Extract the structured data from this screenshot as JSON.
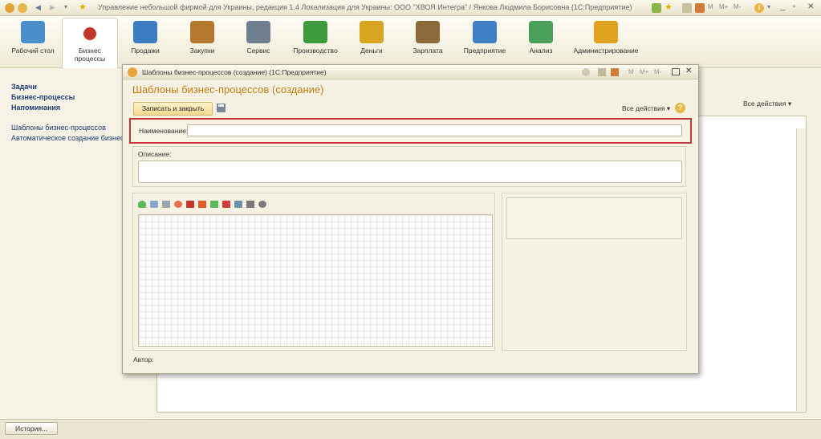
{
  "window": {
    "title": "Управление небольшой фирмой для Украины, редакция 1.4 Локализация для Украины: ООО \"ХВОЯ Интегра\" / Янкова Людмила Борисовна (1С:Предприятие)"
  },
  "sections": [
    {
      "label": "Рабочий стол",
      "icon": "desk-lamp-icon",
      "color": "#4a8fc9"
    },
    {
      "label": "Бизнес процессы",
      "icon": "business-process-icon",
      "color": "#c0392b"
    },
    {
      "label": "Продажи",
      "icon": "cash-register-icon",
      "color": "#3b7bbf"
    },
    {
      "label": "Закупки",
      "icon": "boxes-icon",
      "color": "#b5792d"
    },
    {
      "label": "Сервис",
      "icon": "tools-icon",
      "color": "#6f7f8f"
    },
    {
      "label": "Производство",
      "icon": "factory-icon",
      "color": "#3d9b3d"
    },
    {
      "label": "Деньги",
      "icon": "coins-icon",
      "color": "#d9a520"
    },
    {
      "label": "Зарплата",
      "icon": "worker-icon",
      "color": "#8a6a3b"
    },
    {
      "label": "Предприятие",
      "icon": "building-icon",
      "color": "#3f7fc4"
    },
    {
      "label": "Анализ",
      "icon": "chart-icon",
      "color": "#4aa05a"
    },
    {
      "label": "Администрирование",
      "icon": "admin-computer-icon",
      "color": "#e0a321"
    }
  ],
  "left_nav": {
    "bold_items": [
      "Задачи",
      "Бизнес-процессы",
      "Напоминания"
    ],
    "items": [
      "Шаблоны бизнес-процессов",
      "Автоматическое создание бизнес-пр"
    ]
  },
  "background_form": {
    "all_actions": "Все действия ▾"
  },
  "dialog": {
    "title": "Шаблоны бизнес-процессов (создание)  (1С:Предприятие)",
    "heading": "Шаблоны бизнес-процессов (создание)",
    "save_close": "Записать и закрыть",
    "all_actions": "Все действия ▾",
    "help": "?",
    "name_label": "Наименование:",
    "name_value": "",
    "desc_label": "Описание:",
    "desc_value": "",
    "author_label": "Автор:",
    "window_buttons": {
      "m": "M",
      "mplus": "M+",
      "mminus": "M-"
    }
  },
  "palette": [
    {
      "icon": "start-point-icon",
      "color": "#5cb85c"
    },
    {
      "icon": "action-point-icon",
      "color": "#8aa8cc"
    },
    {
      "icon": "subprocess-icon",
      "color": "#9aa4ae"
    },
    {
      "icon": "condition-icon",
      "color": "#e07050"
    },
    {
      "icon": "processing-icon",
      "color": "#c0392b"
    },
    {
      "icon": "split-icon",
      "color": "#e05a2a"
    },
    {
      "icon": "merge-icon",
      "color": "#5cb85c"
    },
    {
      "icon": "stop-point-icon",
      "color": "#d23c3c"
    },
    {
      "icon": "decoration-icon",
      "color": "#6f8fa8"
    },
    {
      "icon": "connector-icon",
      "color": "#7a7a7a"
    },
    {
      "icon": "group-icon",
      "color": "#7a7a7a"
    }
  ],
  "statusbar": {
    "history": "История..."
  }
}
